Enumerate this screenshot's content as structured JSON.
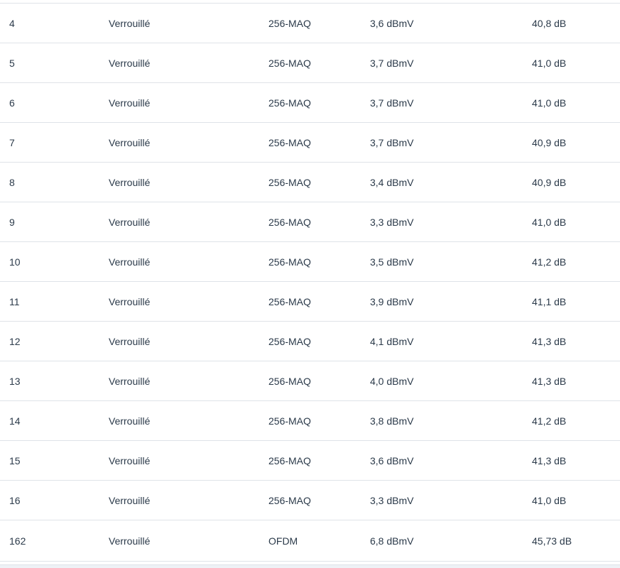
{
  "table": {
    "rows": [
      {
        "id": "4",
        "status": "Verrouillé",
        "modulation": "256-MAQ",
        "power": "3,6 dBmV",
        "snr": "40,8 dB"
      },
      {
        "id": "5",
        "status": "Verrouillé",
        "modulation": "256-MAQ",
        "power": "3,7 dBmV",
        "snr": "41,0 dB"
      },
      {
        "id": "6",
        "status": "Verrouillé",
        "modulation": "256-MAQ",
        "power": "3,7 dBmV",
        "snr": "41,0 dB"
      },
      {
        "id": "7",
        "status": "Verrouillé",
        "modulation": "256-MAQ",
        "power": "3,7 dBmV",
        "snr": "40,9 dB"
      },
      {
        "id": "8",
        "status": "Verrouillé",
        "modulation": "256-MAQ",
        "power": "3,4 dBmV",
        "snr": "40,9 dB"
      },
      {
        "id": "9",
        "status": "Verrouillé",
        "modulation": "256-MAQ",
        "power": "3,3 dBmV",
        "snr": "41,0 dB"
      },
      {
        "id": "10",
        "status": "Verrouillé",
        "modulation": "256-MAQ",
        "power": "3,5 dBmV",
        "snr": "41,2 dB"
      },
      {
        "id": "11",
        "status": "Verrouillé",
        "modulation": "256-MAQ",
        "power": "3,9 dBmV",
        "snr": "41,1 dB"
      },
      {
        "id": "12",
        "status": "Verrouillé",
        "modulation": "256-MAQ",
        "power": "4,1 dBmV",
        "snr": "41,3 dB"
      },
      {
        "id": "13",
        "status": "Verrouillé",
        "modulation": "256-MAQ",
        "power": "4,0 dBmV",
        "snr": "41,3 dB"
      },
      {
        "id": "14",
        "status": "Verrouillé",
        "modulation": "256-MAQ",
        "power": "3,8 dBmV",
        "snr": "41,2 dB"
      },
      {
        "id": "15",
        "status": "Verrouillé",
        "modulation": "256-MAQ",
        "power": "3,6 dBmV",
        "snr": "41,3 dB"
      },
      {
        "id": "16",
        "status": "Verrouillé",
        "modulation": "256-MAQ",
        "power": "3,3 dBmV",
        "snr": "41,0 dB"
      },
      {
        "id": "162",
        "status": "Verrouillé",
        "modulation": "OFDM",
        "power": "6,8 dBmV",
        "snr": "45,73 dB"
      }
    ]
  }
}
